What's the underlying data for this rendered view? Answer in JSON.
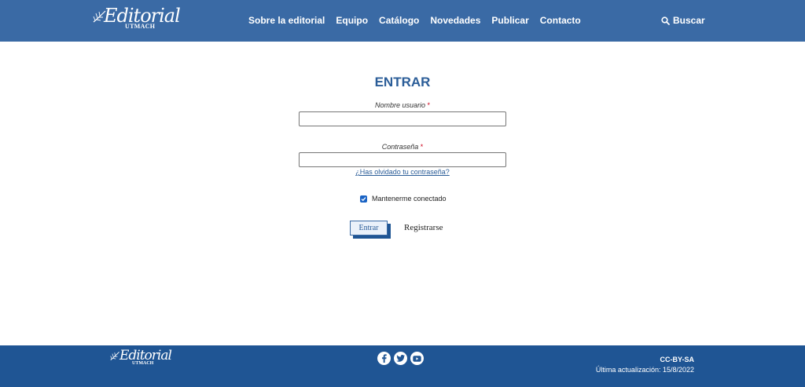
{
  "header": {
    "logo": {
      "script": "Editorial",
      "sub": "UTMACH"
    },
    "nav": [
      "Sobre la editorial",
      "Equipo",
      "Catálogo",
      "Novedades",
      "Publicar",
      "Contacto"
    ],
    "search_label": "Buscar"
  },
  "login": {
    "title": "ENTRAR",
    "username_label": "Nombre usuario",
    "password_label": "Contraseña",
    "required_mark": "*",
    "username_value": "",
    "password_value": "",
    "forgot_link": "¿Has olvidado tu contraseña?",
    "remember_label": "Mantenerme conectado",
    "remember_checked": true,
    "submit_label": "Entrar",
    "register_label": "Registrarse"
  },
  "footer": {
    "logo": {
      "script": "Editorial",
      "sub": "UTMACH"
    },
    "social_icons": [
      "facebook-icon",
      "twitter-icon",
      "youtube-icon"
    ],
    "license": "CC-BY-SA",
    "updated": "Última actualización: 15/8/2022"
  },
  "colors": {
    "header_bg": "#3a6aa5",
    "footer_bg": "#1f5594",
    "accent": "#2b5d98",
    "required": "#d0021b"
  }
}
